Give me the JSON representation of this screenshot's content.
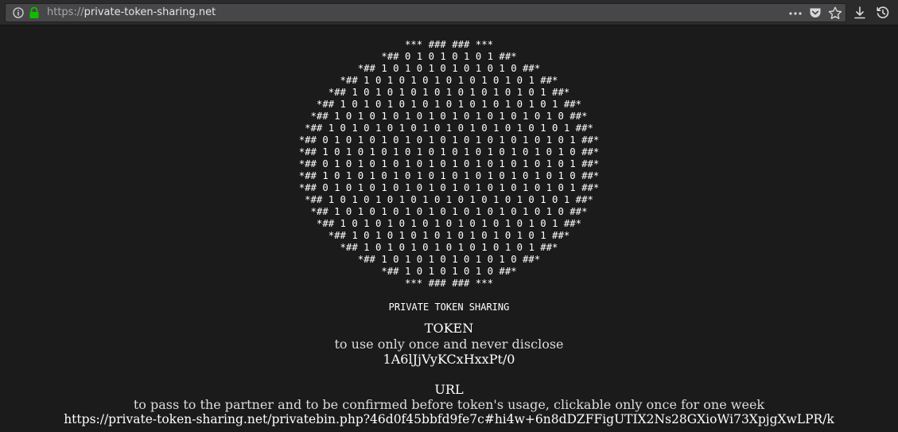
{
  "browser": {
    "url_scheme": "https://",
    "url_host": "private-token-sharing.net",
    "icons": {
      "info": "info-icon",
      "lock": "lock-icon",
      "page_actions": "more-dots-icon",
      "pocket": "pocket-icon",
      "bookmark": "star-icon",
      "downloads": "download-icon",
      "history": "history-icon"
    },
    "colors": {
      "lock": "#12bc00",
      "toolbar": "#2b2b2b",
      "urlbar": "#474749",
      "page_background": "#1b1b1b"
    }
  },
  "page": {
    "ascii_art": [
      "*** ### ### ***",
      "*## 0 1 0 1 0 1 0 1 ##*",
      "*## 1 0 1 0 1 0 1 0 1 0 1 0 ##*",
      "*## 1 0 1 0 1 0 1 0 1 0 1 0 1 0 1 ##*",
      "*## 1 0 1 0 1 0 1 0 1 0 1 0 1 0 1 0 1 ##*",
      "*## 1 0 1 0 1 0 1 0 1 0 1 0 1 0 1 0 1 0 1 ##*",
      "*## 1 0 1 0 1 0 1 0 1 0 1 0 1 0 1 0 1 0 1 0 ##*",
      "*## 1 0 1 0 1 0 1 0 1 0 1 0 1 0 1 0 1 0 1 0 1 ##*",
      "*## 0 1 0 1 0 1 0 1 0 1 0 1 0 1 0 1 0 1 0 1 0 1 ##*",
      "*## 1 0 1 0 1 0 1 0 1 0 1 0 1 0 1 0 1 0 1 0 1 0 ##*",
      "*## 0 1 0 1 0 1 0 1 0 1 0 1 0 1 0 1 0 1 0 1 0 1 ##*",
      "*## 1 0 1 0 1 0 1 0 1 0 1 0 1 0 1 0 1 0 1 0 1 0 ##*",
      "*## 0 1 0 1 0 1 0 1 0 1 0 1 0 1 0 1 0 1 0 1 0 1 ##*",
      "*## 1 0 1 0 1 0 1 0 1 0 1 0 1 0 1 0 1 0 1 0 1 ##*",
      "*## 1 0 1 0 1 0 1 0 1 0 1 0 1 0 1 0 1 0 1 0 ##*",
      "*## 1 0 1 0 1 0 1 0 1 0 1 0 1 0 1 0 1 0 1 ##*",
      "*## 1 0 1 0 1 0 1 0 1 0 1 0 1 0 1 0 1 ##*",
      "*## 1 0 1 0 1 0 1 0 1 0 1 0 1 0 1 ##*",
      "*## 1 0 1 0 1 0 1 0 1 0 1 0 ##*",
      "*## 1 0 1 0 1 0 1 0 ##*",
      "*** ### ### ***"
    ],
    "site_title": "PRIVATE TOKEN SHARING",
    "token": {
      "heading": "TOKEN",
      "subtitle": "to use only once and never disclose",
      "value": "1A6lJjVyKCxHxxPt/0"
    },
    "url_section": {
      "heading": "URL",
      "subtitle": "to pass to the partner and to be confirmed before token's usage, clickable only once for one week",
      "value": "https://private-token-sharing.net/privatebin.php?46d0f45bbfd9fe7c#hi4w+6n8dDZFFigUTIX2Ns28GXioWi73XpjgXwLPR/k"
    }
  }
}
